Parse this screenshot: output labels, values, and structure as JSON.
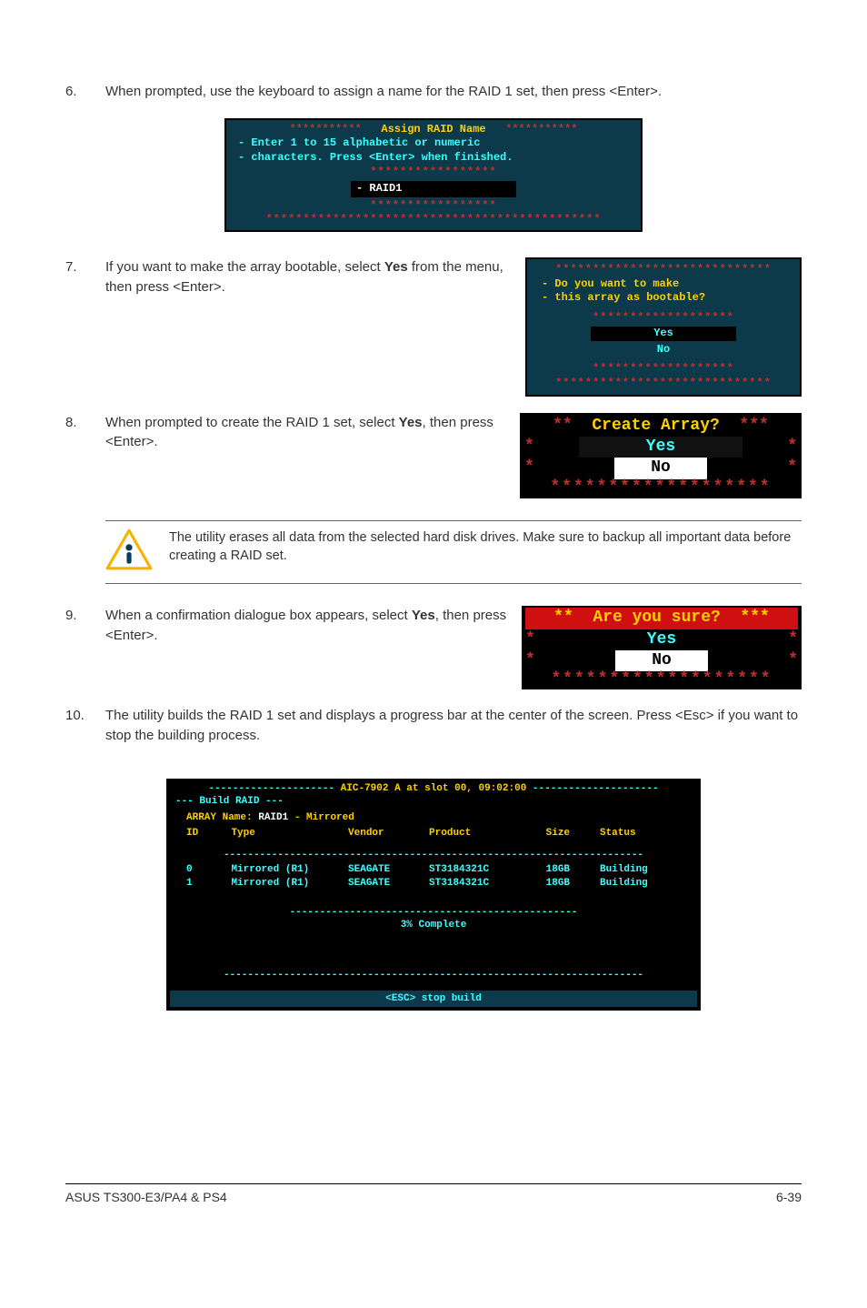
{
  "steps": {
    "s6": {
      "num": "6.",
      "text": "When prompted, use the keyboard to assign a name for the RAID 1 set, then press <Enter>."
    },
    "s7": {
      "num": "7.",
      "text_a": "If you want to make the array bootable, select ",
      "bold": "Yes",
      "text_b": " from the menu, then press <Enter>."
    },
    "s8": {
      "num": "8.",
      "text_a": "When prompted to create the RAID 1 set, select ",
      "bold": "Yes",
      "text_b": ", then press <Enter>."
    },
    "s9": {
      "num": "9.",
      "text_a": "When a confirmation dialogue box appears, select ",
      "bold": "Yes",
      "text_b": ", then press <Enter>."
    },
    "s10": {
      "num": "10.",
      "text": "The utility builds the RAID 1 set and displays a progress bar at the center of the screen. Press <Esc> if you want to stop the building process."
    }
  },
  "note": "The utility erases all data from the selected hard disk drives. Make sure to backup all important data before creating a RAID set.",
  "assign": {
    "stars": "***********",
    "title": "Assign RAID Name",
    "line1": "Enter 1 to 15 alphabetic or numeric",
    "line2": "characters. Press <Enter> when finished.",
    "border": "*****************",
    "input": "- RAID1",
    "bottom": "*********************************************"
  },
  "boot": {
    "top": "*****************************",
    "q1": "Do you want to make",
    "q2": "this array as bootable?",
    "inner": "*******************",
    "yes": "Yes",
    "no": "No",
    "bottom": "*****************************"
  },
  "create": {
    "title": "Create Array?",
    "yes": "Yes",
    "no": "No",
    "stars": "*******************"
  },
  "sure": {
    "title": "Are you sure?",
    "yes": "Yes",
    "no": "No",
    "stars": "*******************"
  },
  "build": {
    "top_left": "---------------------",
    "top_mid": " AIC-7902 A at slot 00, 09:02:00 ",
    "top_right": "---------------------",
    "section": "--- Build RAID ---",
    "array_label": "ARRAY Name: ",
    "array_name": "RAID1",
    "array_suffix": " - Mirrored",
    "cols": [
      "ID",
      "Type",
      "Vendor",
      "Product",
      "Size",
      "Status"
    ],
    "rows": [
      [
        "0",
        "Mirrored (R1)",
        "SEAGATE",
        "ST3184321C",
        "18GB",
        "Building"
      ],
      [
        "1",
        "Mirrored (R1)",
        "SEAGATE",
        "ST3184321C",
        "18GB",
        "Building"
      ]
    ],
    "progress_border": "------------------------------------------------",
    "progress": "3% Complete",
    "esc": "<ESC> stop build"
  },
  "footer": {
    "left": "ASUS TS300-E3/PA4 & PS4",
    "right": "6-39"
  }
}
